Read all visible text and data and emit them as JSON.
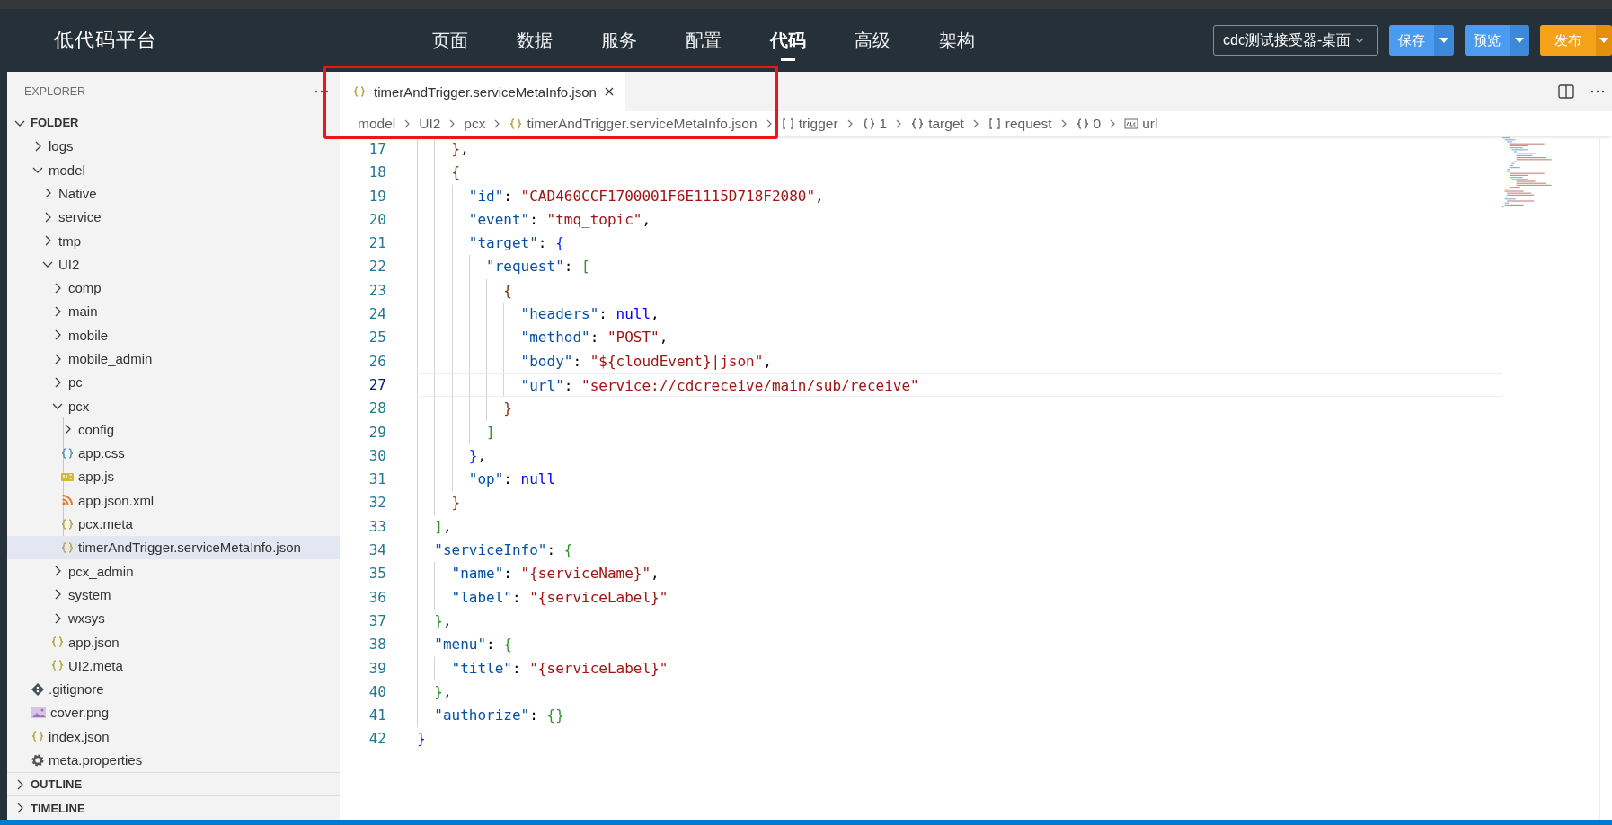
{
  "header": {
    "title": "低代码平台",
    "nav": [
      {
        "label": "页面",
        "selected": false
      },
      {
        "label": "数据",
        "selected": false
      },
      {
        "label": "服务",
        "selected": false
      },
      {
        "label": "配置",
        "selected": false
      },
      {
        "label": "代码",
        "selected": true
      },
      {
        "label": "高级",
        "selected": false
      },
      {
        "label": "架构",
        "selected": false
      }
    ],
    "project_select": {
      "value": "cdc测试接受器-桌面"
    },
    "buttons": [
      {
        "label": "保存",
        "kind": "save"
      },
      {
        "label": "预览",
        "kind": "preview"
      },
      {
        "label": "发布",
        "kind": "publish"
      }
    ]
  },
  "sidebar": {
    "title": "EXPLORER",
    "tree": [
      {
        "label": "FOLDER",
        "kind": "root",
        "expanded": true,
        "selected": false,
        "children": [
          {
            "label": "logs",
            "kind": "folder",
            "expanded": false,
            "selected": false
          },
          {
            "label": "model",
            "kind": "folder",
            "expanded": true,
            "selected": false,
            "children": [
              {
                "label": "Native",
                "kind": "folder",
                "expanded": false,
                "selected": false
              },
              {
                "label": "service",
                "kind": "folder",
                "expanded": false,
                "selected": false
              },
              {
                "label": "tmp",
                "kind": "folder",
                "expanded": false,
                "selected": false
              },
              {
                "label": "UI2",
                "kind": "folder",
                "expanded": true,
                "selected": false,
                "children": [
                  {
                    "label": "comp",
                    "kind": "folder",
                    "expanded": false,
                    "selected": false
                  },
                  {
                    "label": "main",
                    "kind": "folder",
                    "expanded": false,
                    "selected": false
                  },
                  {
                    "label": "mobile",
                    "kind": "folder",
                    "expanded": false,
                    "selected": false
                  },
                  {
                    "label": "mobile_admin",
                    "kind": "folder",
                    "expanded": false,
                    "selected": false
                  },
                  {
                    "label": "pc",
                    "kind": "folder",
                    "expanded": false,
                    "selected": false
                  },
                  {
                    "label": "pcx",
                    "kind": "folder",
                    "expanded": true,
                    "selected": false,
                    "children": [
                      {
                        "label": "config",
                        "kind": "folder",
                        "expanded": false,
                        "selected": false
                      },
                      {
                        "label": "app.css",
                        "kind": "css",
                        "selected": false
                      },
                      {
                        "label": "app.js",
                        "kind": "js",
                        "selected": false
                      },
                      {
                        "label": "app.json.xml",
                        "kind": "xml",
                        "selected": false
                      },
                      {
                        "label": "pcx.meta",
                        "kind": "json",
                        "selected": false
                      },
                      {
                        "label": "timerAndTrigger.serviceMetaInfo.json",
                        "kind": "json",
                        "selected": true
                      }
                    ]
                  },
                  {
                    "label": "pcx_admin",
                    "kind": "folder",
                    "expanded": false,
                    "selected": false
                  },
                  {
                    "label": "system",
                    "kind": "folder",
                    "expanded": false,
                    "selected": false
                  },
                  {
                    "label": "wxsys",
                    "kind": "folder",
                    "expanded": false,
                    "selected": false
                  },
                  {
                    "label": "app.json",
                    "kind": "json",
                    "selected": false
                  },
                  {
                    "label": "UI2.meta",
                    "kind": "json",
                    "selected": false
                  }
                ]
              }
            ]
          },
          {
            "label": ".gitignore",
            "kind": "git",
            "selected": false
          },
          {
            "label": "cover.png",
            "kind": "image",
            "selected": false
          },
          {
            "label": "index.json",
            "kind": "json",
            "selected": false
          },
          {
            "label": "meta.properties",
            "kind": "gear",
            "selected": false
          }
        ]
      }
    ],
    "sections": [
      {
        "label": "OUTLINE",
        "expanded": false
      },
      {
        "label": "TIMELINE",
        "expanded": false
      }
    ]
  },
  "editor": {
    "tabs": [
      {
        "label": "timerAndTrigger.serviceMetaInfo.json",
        "kind": "json",
        "selected": true
      }
    ],
    "breadcrumbs": [
      {
        "label": "model",
        "kind": "folder"
      },
      {
        "label": "UI2",
        "kind": "folder"
      },
      {
        "label": "pcx",
        "kind": "folder"
      },
      {
        "label": "timerAndTrigger.serviceMetaInfo.json",
        "kind": "json"
      },
      {
        "label": "trigger",
        "kind": "array"
      },
      {
        "label": "1",
        "kind": "object"
      },
      {
        "label": "target",
        "kind": "object"
      },
      {
        "label": "request",
        "kind": "array"
      },
      {
        "label": "0",
        "kind": "object"
      },
      {
        "label": "url",
        "kind": "string"
      }
    ],
    "lines": [
      {
        "number": "17",
        "current": false,
        "tokens": [
          {
            "kind": "b3",
            "text": "    }"
          },
          {
            "kind": "punct",
            "text": ","
          }
        ]
      },
      {
        "number": "18",
        "current": false,
        "tokens": [
          {
            "kind": "b3",
            "text": "    {"
          }
        ]
      },
      {
        "number": "19",
        "current": false,
        "tokens": [
          {
            "kind": "key",
            "text": "      \"id\""
          },
          {
            "kind": "punct",
            "text": ": "
          },
          {
            "kind": "str",
            "text": "\"CAD460CCF1700001F6E1115D718F2080\""
          },
          {
            "kind": "punct",
            "text": ","
          }
        ]
      },
      {
        "number": "20",
        "current": false,
        "tokens": [
          {
            "kind": "key",
            "text": "      \"event\""
          },
          {
            "kind": "punct",
            "text": ": "
          },
          {
            "kind": "str",
            "text": "\"tmq_topic\""
          },
          {
            "kind": "punct",
            "text": ","
          }
        ]
      },
      {
        "number": "21",
        "current": false,
        "tokens": [
          {
            "kind": "key",
            "text": "      \"target\""
          },
          {
            "kind": "punct",
            "text": ": "
          },
          {
            "kind": "b1",
            "text": "{"
          }
        ]
      },
      {
        "number": "22",
        "current": false,
        "tokens": [
          {
            "kind": "key",
            "text": "        \"request\""
          },
          {
            "kind": "punct",
            "text": ": "
          },
          {
            "kind": "b2",
            "text": "["
          }
        ]
      },
      {
        "number": "23",
        "current": false,
        "tokens": [
          {
            "kind": "b3",
            "text": "          {"
          }
        ]
      },
      {
        "number": "24",
        "current": false,
        "tokens": [
          {
            "kind": "key",
            "text": "            \"headers\""
          },
          {
            "kind": "punct",
            "text": ": "
          },
          {
            "kind": "kw",
            "text": "null"
          },
          {
            "kind": "punct",
            "text": ","
          }
        ]
      },
      {
        "number": "25",
        "current": false,
        "tokens": [
          {
            "kind": "key",
            "text": "            \"method\""
          },
          {
            "kind": "punct",
            "text": ": "
          },
          {
            "kind": "str",
            "text": "\"POST\""
          },
          {
            "kind": "punct",
            "text": ","
          }
        ]
      },
      {
        "number": "26",
        "current": false,
        "tokens": [
          {
            "kind": "key",
            "text": "            \"body\""
          },
          {
            "kind": "punct",
            "text": ": "
          },
          {
            "kind": "str",
            "text": "\"${cloudEvent}|json\""
          },
          {
            "kind": "punct",
            "text": ","
          }
        ]
      },
      {
        "number": "27",
        "current": true,
        "tokens": [
          {
            "kind": "key",
            "text": "            \"url\""
          },
          {
            "kind": "punct",
            "text": ": "
          },
          {
            "kind": "str",
            "text": "\"service://cdcreceive/main/sub/receive\""
          }
        ]
      },
      {
        "number": "28",
        "current": false,
        "tokens": [
          {
            "kind": "b3",
            "text": "          }"
          }
        ]
      },
      {
        "number": "29",
        "current": false,
        "tokens": [
          {
            "kind": "b2",
            "text": "        ]"
          }
        ]
      },
      {
        "number": "30",
        "current": false,
        "tokens": [
          {
            "kind": "b1",
            "text": "      }"
          },
          {
            "kind": "punct",
            "text": ","
          }
        ]
      },
      {
        "number": "31",
        "current": false,
        "tokens": [
          {
            "kind": "key",
            "text": "      \"op\""
          },
          {
            "kind": "punct",
            "text": ": "
          },
          {
            "kind": "kw",
            "text": "null"
          }
        ]
      },
      {
        "number": "32",
        "current": false,
        "tokens": [
          {
            "kind": "b3",
            "text": "    }"
          }
        ]
      },
      {
        "number": "33",
        "current": false,
        "tokens": [
          {
            "kind": "b2",
            "text": "  ]"
          },
          {
            "kind": "punct",
            "text": ","
          }
        ]
      },
      {
        "number": "34",
        "current": false,
        "tokens": [
          {
            "kind": "key",
            "text": "  \"serviceInfo\""
          },
          {
            "kind": "punct",
            "text": ": "
          },
          {
            "kind": "b2",
            "text": "{"
          }
        ]
      },
      {
        "number": "35",
        "current": false,
        "tokens": [
          {
            "kind": "key",
            "text": "    \"name\""
          },
          {
            "kind": "punct",
            "text": ": "
          },
          {
            "kind": "str",
            "text": "\"{serviceName}\""
          },
          {
            "kind": "punct",
            "text": ","
          }
        ]
      },
      {
        "number": "36",
        "current": false,
        "tokens": [
          {
            "kind": "key",
            "text": "    \"label\""
          },
          {
            "kind": "punct",
            "text": ": "
          },
          {
            "kind": "str",
            "text": "\"{serviceLabel}\""
          }
        ]
      },
      {
        "number": "37",
        "current": false,
        "tokens": [
          {
            "kind": "b2",
            "text": "  }"
          },
          {
            "kind": "punct",
            "text": ","
          }
        ]
      },
      {
        "number": "38",
        "current": false,
        "tokens": [
          {
            "kind": "key",
            "text": "  \"menu\""
          },
          {
            "kind": "punct",
            "text": ": "
          },
          {
            "kind": "b2",
            "text": "{"
          }
        ]
      },
      {
        "number": "39",
        "current": false,
        "tokens": [
          {
            "kind": "key",
            "text": "    \"title\""
          },
          {
            "kind": "punct",
            "text": ": "
          },
          {
            "kind": "str",
            "text": "\"{serviceLabel}\""
          }
        ]
      },
      {
        "number": "40",
        "current": false,
        "tokens": [
          {
            "kind": "b2",
            "text": "  }"
          },
          {
            "kind": "punct",
            "text": ","
          }
        ]
      },
      {
        "number": "41",
        "current": false,
        "tokens": [
          {
            "kind": "key",
            "text": "  \"authorize\""
          },
          {
            "kind": "punct",
            "text": ": "
          },
          {
            "kind": "b2",
            "text": "{}"
          }
        ]
      },
      {
        "number": "42",
        "current": false,
        "tokens": [
          {
            "kind": "b1",
            "text": "}"
          }
        ]
      }
    ]
  }
}
